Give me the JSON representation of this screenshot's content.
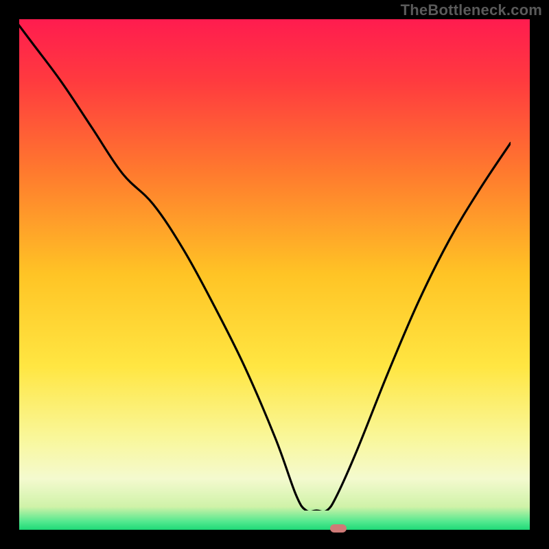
{
  "watermark": "TheBottleneck.com",
  "colors": {
    "frame": "#000000",
    "watermark": "#5a5a5a",
    "curve": "#000000",
    "marker": "#cf7a77",
    "gradient_stops": [
      {
        "offset": 0.0,
        "color": "#ff1c4f"
      },
      {
        "offset": 0.12,
        "color": "#ff3a3f"
      },
      {
        "offset": 0.3,
        "color": "#ff7a2e"
      },
      {
        "offset": 0.5,
        "color": "#ffc425"
      },
      {
        "offset": 0.68,
        "color": "#ffe642"
      },
      {
        "offset": 0.82,
        "color": "#f9f79a"
      },
      {
        "offset": 0.9,
        "color": "#f4facf"
      },
      {
        "offset": 0.955,
        "color": "#cff2a8"
      },
      {
        "offset": 0.985,
        "color": "#4fe88e"
      },
      {
        "offset": 1.0,
        "color": "#1fd977"
      }
    ]
  },
  "chart_data": {
    "type": "line",
    "title": "",
    "xlabel": "",
    "ylabel": "",
    "xlim": [
      0,
      100
    ],
    "ylim": [
      0,
      100
    ],
    "series": [
      {
        "name": "bottleneck-curve",
        "x": [
          0,
          6,
          12,
          18,
          24,
          30,
          36,
          42,
          48,
          54,
          58,
          60,
          62,
          64,
          66,
          70,
          76,
          82,
          88,
          94,
          100
        ],
        "y": [
          100,
          92,
          84,
          75,
          66,
          60,
          51,
          40,
          28,
          14,
          3,
          0,
          0,
          0,
          3,
          12,
          27,
          41,
          53,
          63,
          72
        ]
      }
    ],
    "marker": {
      "x": 62.5,
      "y": 0
    }
  }
}
